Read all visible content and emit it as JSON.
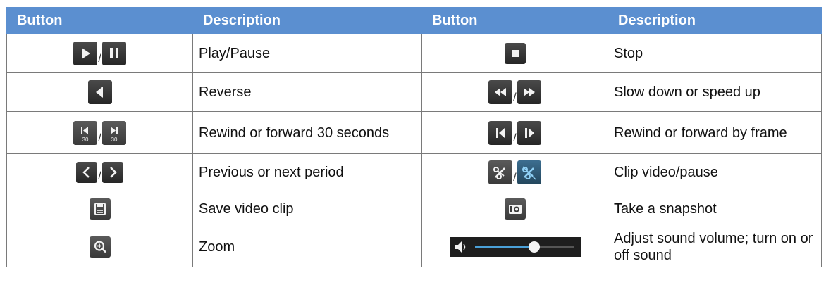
{
  "headers": [
    "Button",
    "Description",
    "Button",
    "Description"
  ],
  "rows": [
    {
      "left_icons": [
        "play-icon",
        "pause-icon"
      ],
      "left_desc": "Play/Pause",
      "right_icons": [
        "stop-icon"
      ],
      "right_desc": "Stop"
    },
    {
      "left_icons": [
        "reverse-icon"
      ],
      "left_desc": "Reverse",
      "right_icons": [
        "slow-down-icon",
        "speed-up-icon"
      ],
      "right_desc": "Slow down or speed up"
    },
    {
      "left_icons": [
        "rewind-30-icon",
        "forward-30-icon"
      ],
      "left_desc": "Rewind or forward 30 seconds",
      "right_icons": [
        "frame-back-icon",
        "frame-forward-icon"
      ],
      "right_desc": "Rewind or forward by frame"
    },
    {
      "left_icons": [
        "previous-period-icon",
        "next-period-icon"
      ],
      "left_desc": "Previous or next period",
      "right_icons": [
        "clip-video-icon",
        "clip-pause-icon"
      ],
      "right_desc": "Clip video/pause"
    },
    {
      "left_icons": [
        "save-clip-icon"
      ],
      "left_desc": "Save video clip",
      "right_icons": [
        "snapshot-icon"
      ],
      "right_desc": "Take a snapshot"
    },
    {
      "left_icons": [
        "zoom-icon"
      ],
      "left_desc": "Zoom",
      "right_icons": [
        "volume-slider"
      ],
      "right_desc": "Adjust sound volume; turn on or off sound"
    }
  ],
  "icon_labels": {
    "thirty": "30",
    "separator": "/"
  },
  "volume_level": 0.6,
  "colors": {
    "header_bg": "#5b8fd0",
    "header_text": "#ffffff",
    "border": "#7a7a7a",
    "button_bg": "#2f2f2f",
    "accent_blue": "#4aa0d8"
  }
}
